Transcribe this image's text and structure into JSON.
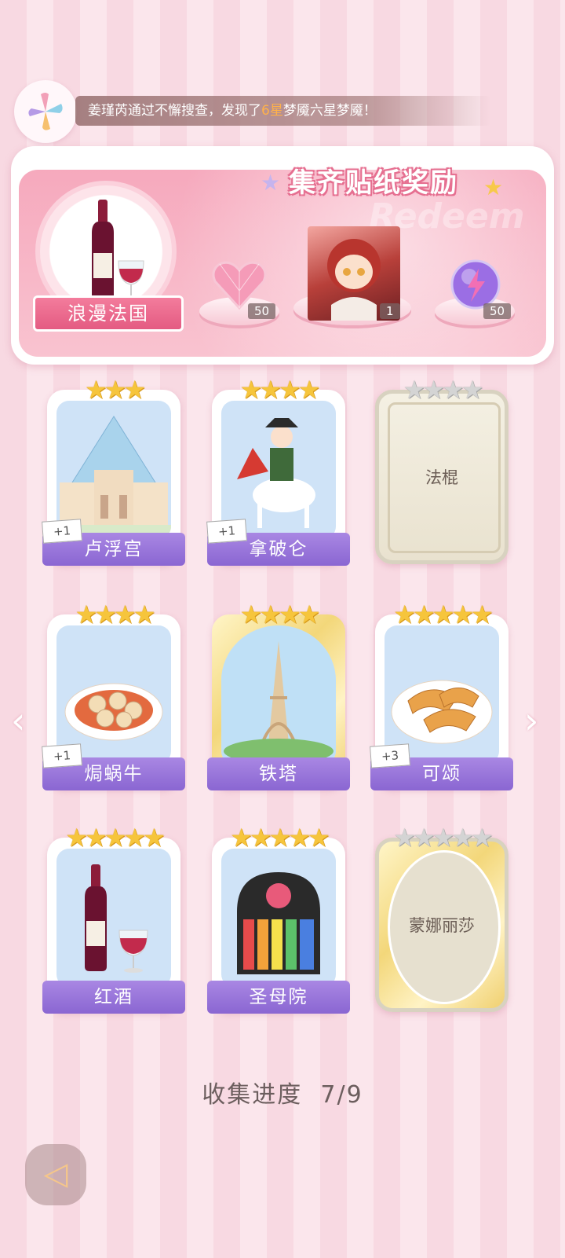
{
  "news": {
    "prefix": "姜瑾芮通过不懈搜查，发现了",
    "highlight": "6星",
    "suffix": "梦魇六星梦魇！"
  },
  "reward": {
    "title": "集齐贴纸奖励",
    "bg_word": "Redeem",
    "set_name": "浪漫法国",
    "items": [
      {
        "icon": "pink-heart-gem-icon",
        "count": "50"
      },
      {
        "icon": "character-portrait",
        "count": "1"
      },
      {
        "icon": "purple-lightning-orb-icon",
        "count": "50"
      }
    ]
  },
  "cards": [
    {
      "name": "卢浮宫",
      "stars": 3,
      "max_stars": 3,
      "plus": "+1",
      "state": "owned"
    },
    {
      "name": "拿破仑",
      "stars": 4,
      "max_stars": 4,
      "plus": "+1",
      "state": "owned"
    },
    {
      "name": "法棍",
      "stars": 0,
      "max_stars": 4,
      "plus": "",
      "state": "locked"
    },
    {
      "name": "焗蜗牛",
      "stars": 4,
      "max_stars": 4,
      "plus": "+1",
      "state": "owned"
    },
    {
      "name": "铁塔",
      "stars": 4,
      "max_stars": 4,
      "plus": "",
      "state": "owned-gold"
    },
    {
      "name": "可颂",
      "stars": 5,
      "max_stars": 5,
      "plus": "+3",
      "state": "owned"
    },
    {
      "name": "红酒",
      "stars": 5,
      "max_stars": 5,
      "plus": "",
      "state": "owned"
    },
    {
      "name": "圣母院",
      "stars": 5,
      "max_stars": 5,
      "plus": "",
      "state": "owned"
    },
    {
      "name": "蒙娜丽莎",
      "stars": 0,
      "max_stars": 5,
      "plus": "",
      "state": "locked-gold"
    }
  ],
  "progress": {
    "label": "收集进度",
    "value": "7/9"
  },
  "nav": {
    "left_icon": "chevron-left-icon",
    "right_icon": "chevron-right-icon",
    "back_icon": "back-arrow-icon"
  }
}
